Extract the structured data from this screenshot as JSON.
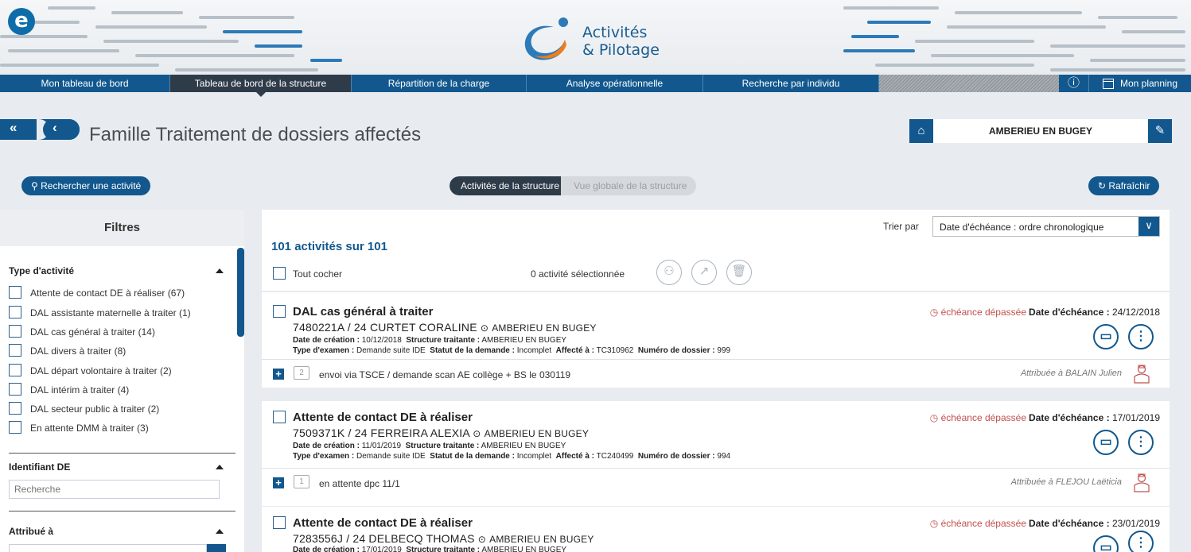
{
  "brand": {
    "logo_letter": "e",
    "line1": "Activités",
    "line2": "& Pilotage",
    "colors": {
      "primary": "#12588e",
      "active_nav": "#2e3b49",
      "overdue": "#c0504d"
    }
  },
  "nav": {
    "items": [
      {
        "label": "Mon tableau de bord",
        "active": false
      },
      {
        "label": "Tableau de bord de la structure",
        "active": true
      },
      {
        "label": "Répartition de la charge",
        "active": false
      },
      {
        "label": "Analyse opérationnelle",
        "active": false
      },
      {
        "label": "Recherche par individu",
        "active": false
      }
    ],
    "info_icon": "info-icon",
    "planning_label": "Mon planning"
  },
  "page": {
    "title": "Famille Traitement de dossiers affectés",
    "structure": "AMBERIEU EN BUGEY"
  },
  "actions": {
    "search_activity": "Rechercher une activité",
    "seg_active": "Activités de la structure",
    "seg_inactive": "Vue globale de la structure",
    "refresh": "Rafraîchir"
  },
  "filters": {
    "title": "Filtres",
    "type_title": "Type d'activité",
    "types": [
      "Attente de contact DE à réaliser (67)",
      "DAL assistante maternelle à traiter (1)",
      "DAL cas général à traiter (14)",
      "DAL divers à traiter (8)",
      "DAL départ volontaire à  traiter (2)",
      "DAL intérim à traiter (4)",
      "DAL secteur public à traiter (2)",
      "En attente DMM à traiter (3)"
    ],
    "id_title": "Identifiant DE",
    "id_placeholder": "Recherche",
    "assigned_title": "Attribué à"
  },
  "list": {
    "count": "101 activités sur 101",
    "sort_label": "Trier par",
    "sort_value": "Date d'échéance : ordre chronologique",
    "check_all": "Tout cocher",
    "selected": "0 activité sélectionnée",
    "cards": [
      {
        "title": "DAL cas général à traiter",
        "id": "7480221A / 24  CURTET CORALINE",
        "location": "AMBERIEU EN BUGEY",
        "created_label": "Date de création :",
        "created": "10/12/2018",
        "structure_label": "Structure traitante :",
        "structure": "AMBERIEU EN BUGEY",
        "exam_label": "Type d'examen :",
        "exam": "Demande suite IDE",
        "status_label": "Statut de la demande :",
        "status": "Incomplet",
        "assigned_code_label": "Affecté à :",
        "assigned_code": "TC310962",
        "file_label": "Numéro de dossier :",
        "file": "999",
        "overdue": "échéance dépassée",
        "due_label": "Date d'échéance :",
        "due": "24/12/2018",
        "comments": "2",
        "comment": "envoi via TSCE / demande scan AE collège + BS le 030119",
        "assigned": "Attribuée à BALAIN Julien"
      },
      {
        "title": "Attente de contact DE à réaliser",
        "id": "7509371K / 24  FERREIRA ALEXIA",
        "location": "AMBERIEU EN BUGEY",
        "created_label": "Date de création :",
        "created": "11/01/2019",
        "structure_label": "Structure traitante :",
        "structure": "AMBERIEU EN BUGEY",
        "exam_label": "Type d'examen :",
        "exam": "Demande suite IDE",
        "status_label": "Statut de la demande :",
        "status": "Incomplet",
        "assigned_code_label": "Affecté à :",
        "assigned_code": "TC240499",
        "file_label": "Numéro de dossier :",
        "file": "994",
        "overdue": "échéance dépassée",
        "due_label": "Date d'échéance :",
        "due": "17/01/2019",
        "comments": "1",
        "comment": "en attente dpc 11/1",
        "assigned": "Attribuée à FLEJOU Laëticia"
      },
      {
        "title": "Attente de contact DE à réaliser",
        "id": "7283556J / 24  DELBECQ THOMAS",
        "location": "AMBERIEU EN BUGEY",
        "created_label": "Date de création :",
        "created": "17/01/2019",
        "structure_label": "Structure traitante :",
        "structure": "AMBERIEU EN BUGEY",
        "overdue": "échéance dépassée",
        "due_label": "Date d'échéance :",
        "due": "23/01/2019"
      }
    ]
  }
}
